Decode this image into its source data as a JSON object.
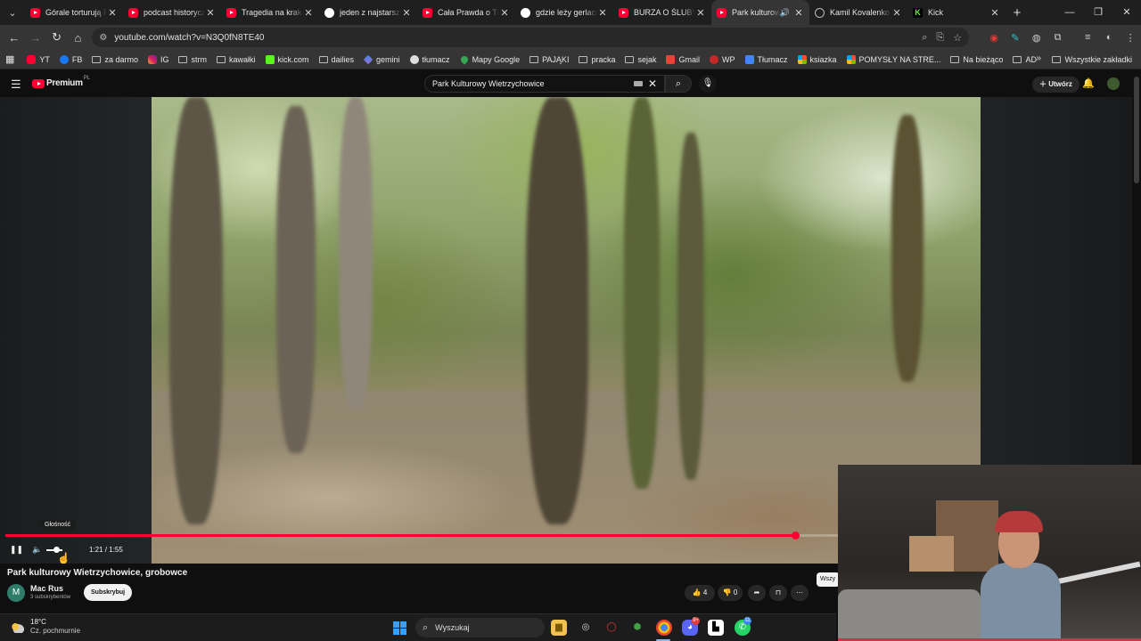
{
  "browser": {
    "tabs": [
      {
        "label": "Górale torturują P",
        "favicon": "youtube-icon",
        "active": false
      },
      {
        "label": "podcast historycz",
        "favicon": "youtube-icon",
        "active": false
      },
      {
        "label": "Tragedia na krako",
        "favicon": "youtube-icon",
        "active": false
      },
      {
        "label": "jeden z najstarszy",
        "favicon": "google-icon",
        "active": false
      },
      {
        "label": "Cała Prawda o TR",
        "favicon": "youtube-icon",
        "active": false
      },
      {
        "label": "gdzie leży gerlach",
        "favicon": "google-icon",
        "active": false
      },
      {
        "label": "BURZA O ŚLUBY P",
        "favicon": "youtube-icon",
        "active": false
      },
      {
        "label": "Park kulturow",
        "favicon": "youtube-icon",
        "active": true
      },
      {
        "label": "Kamil Kovalenko",
        "favicon": "globe-icon",
        "active": false
      },
      {
        "label": "Kick",
        "favicon": "kick-icon",
        "active": false
      }
    ],
    "url": "youtube.com/watch?v=N3Q0fN8TE40",
    "bookmarks": [
      {
        "label": "YT",
        "icon": "youtube-icon"
      },
      {
        "label": "FB",
        "icon": "facebook-icon"
      },
      {
        "label": "za darmo",
        "icon": "folder-icon"
      },
      {
        "label": "IG",
        "icon": "instagram-icon"
      },
      {
        "label": "strm",
        "icon": "folder-icon"
      },
      {
        "label": "kawałki",
        "icon": "folder-icon"
      },
      {
        "label": "kick.com",
        "icon": "kick-icon"
      },
      {
        "label": "dailies",
        "icon": "folder-icon"
      },
      {
        "label": "gemini",
        "icon": "gemini-icon"
      },
      {
        "label": "tłumacz",
        "icon": "translate-icon"
      },
      {
        "label": "Mapy Google",
        "icon": "maps-icon"
      },
      {
        "label": "PAJĄKI",
        "icon": "folder-icon"
      },
      {
        "label": "pracka",
        "icon": "folder-icon"
      },
      {
        "label": "sejak",
        "icon": "folder-icon"
      },
      {
        "label": "Gmail",
        "icon": "gmail-icon"
      },
      {
        "label": "WP",
        "icon": "wp-icon"
      },
      {
        "label": "Tłumacz",
        "icon": "google-translate-icon"
      },
      {
        "label": "ksiazka",
        "icon": "microsoft-icon"
      },
      {
        "label": "POMYSŁY NA STRE...",
        "icon": "microsoft-icon"
      },
      {
        "label": "Na bieżąco",
        "icon": "folder-icon"
      },
      {
        "label": "AD",
        "icon": "folder-icon"
      }
    ],
    "all_bookmarks": "Wszystkie zakładki"
  },
  "youtube": {
    "logo_text": "Premium",
    "logo_suffix": "PL",
    "search_query": "Park Kulturowy Wietrzychowice",
    "create_label": "Utwórz",
    "video": {
      "title": "Park kulturowy Wietrzychowice, grobowce",
      "time_display": "1:21 / 1:55",
      "progress_fraction": 0.704,
      "tooltip": "Głośność"
    },
    "channel": {
      "avatar_letter": "M",
      "name": "Mac Rus",
      "subscribers": "3 subskrybentów",
      "subscribe_label": "Subskrybuj"
    },
    "actions": {
      "likes": "4",
      "dislikes": "0"
    },
    "chip_partial": "Wszy"
  },
  "taskbar": {
    "temperature": "18°C",
    "condition": "Cz. pochmurnie",
    "search_placeholder": "Wyszukaj",
    "discord_badge": "9+",
    "whatsapp_badge": "11"
  },
  "colors": {
    "accent_red": "#ff0033",
    "background": "#0f0f0f"
  }
}
